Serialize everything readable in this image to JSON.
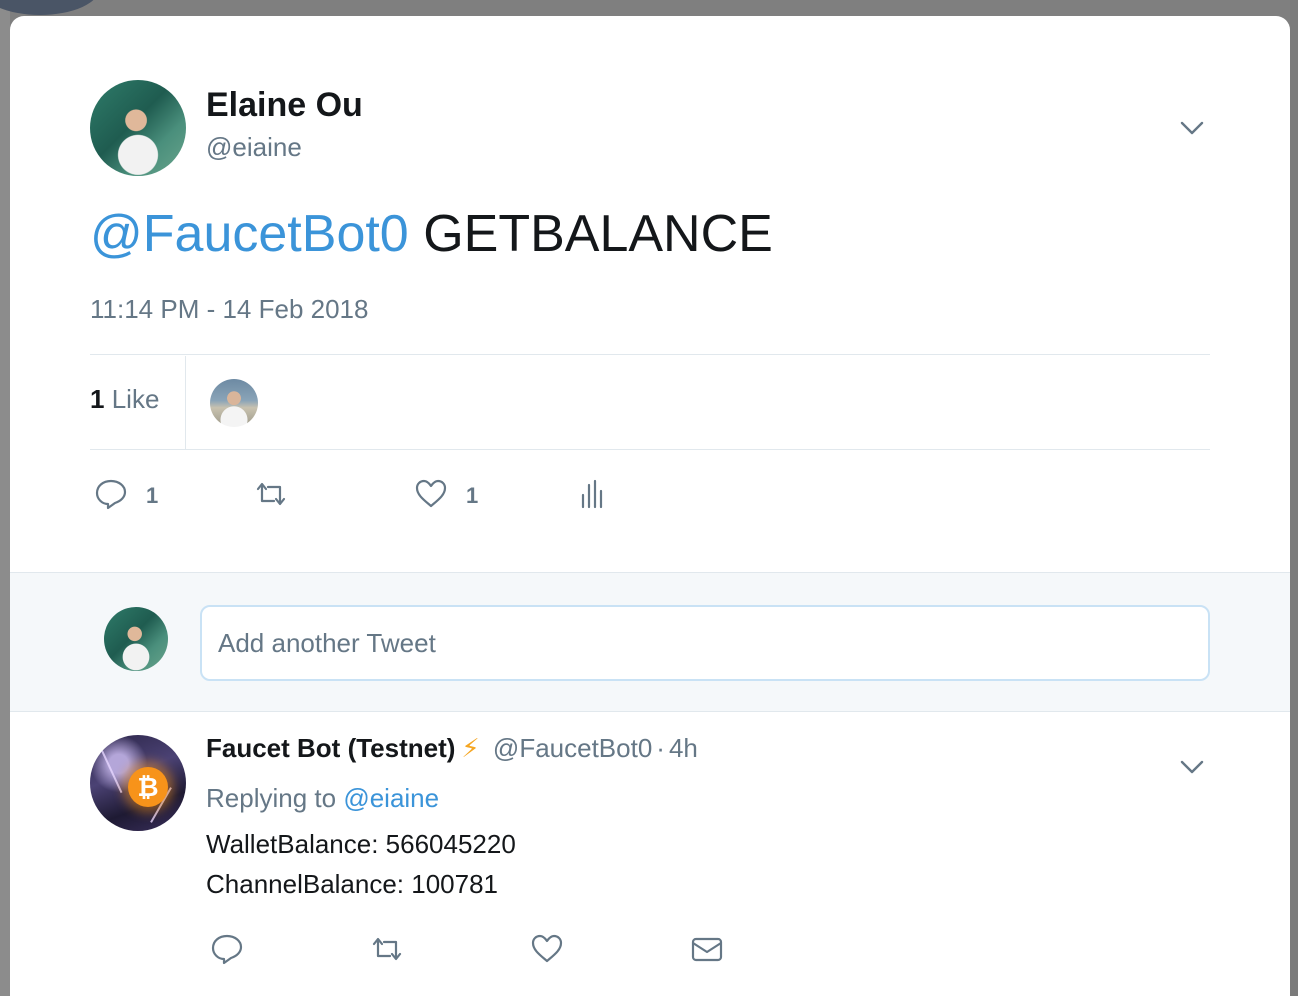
{
  "tweet": {
    "author_name": "Elaine Ou",
    "author_handle": "@eiaine",
    "mention": "@FaucetBot0",
    "body": "GETBALANCE",
    "timestamp": "11:14 PM - 14 Feb 2018",
    "likes_count": "1",
    "likes_word": "Like",
    "actions": {
      "reply_count": "1",
      "retweet_count": "",
      "like_count": "1"
    }
  },
  "compose": {
    "placeholder": "Add another Tweet"
  },
  "reply": {
    "author_name": "Faucet Bot (Testnet)",
    "emoji": "⚡",
    "author_handle": "@FaucetBot0",
    "separator": "·",
    "time": "4h",
    "replying_prefix": "Replying to",
    "replying_to": "@eiaine",
    "line1": "WalletBalance: 566045220",
    "line2": "ChannelBalance: 100781",
    "coin_symbol": "₿"
  },
  "colors": {
    "accent": "#3b94d9",
    "muted": "#657786",
    "text": "#14171a",
    "emoji_bolt": "#f5a623"
  },
  "icons": [
    "chevron-down-icon",
    "reply-icon",
    "retweet-icon",
    "heart-icon",
    "analytics-icon",
    "direct-message-icon",
    "bitcoin-icon"
  ]
}
